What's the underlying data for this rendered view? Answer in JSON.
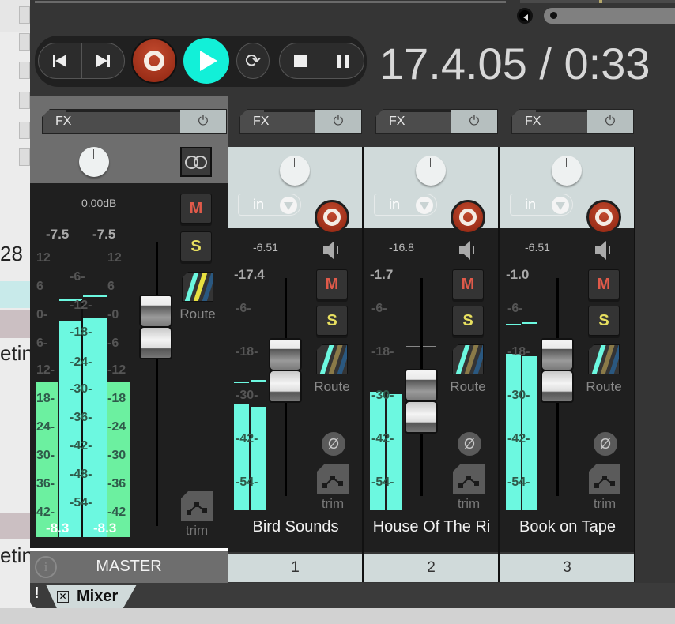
{
  "background": {
    "partial_texts": [
      "28",
      "etin",
      "etin"
    ]
  },
  "transport": {
    "buttons": [
      {
        "name": "go-to-start",
        "icon": "skip-back-icon",
        "glyph": "⏮"
      },
      {
        "name": "go-to-end",
        "icon": "skip-forward-icon",
        "glyph": "⏭"
      },
      {
        "name": "record",
        "icon": "record-icon"
      },
      {
        "name": "play",
        "icon": "play-icon"
      },
      {
        "name": "repeat",
        "icon": "loop-icon",
        "glyph": "⟳"
      },
      {
        "name": "stop",
        "icon": "stop-icon",
        "glyph": "■"
      },
      {
        "name": "pause",
        "icon": "pause-icon",
        "glyph": "❚❚"
      }
    ],
    "position": "17.4.05 / 0:33",
    "colors": {
      "record": "#a8321c",
      "play": "#12f0d8"
    }
  },
  "mixer": {
    "fx_label": "FX",
    "power_glyph": "⏻",
    "master": {
      "name": "MASTER",
      "volume_readout": "0.00dB",
      "peak_left": "-7.5",
      "peak_right": "-7.5",
      "rms_left": "-8.3",
      "rms_right": "-8.3",
      "mute_label": "M",
      "solo_label": "S",
      "route_label": "Route",
      "trim_label": "trim",
      "info_glyph": "i",
      "outer_scale": [
        "12",
        "6",
        "0-",
        "6-",
        "12-",
        "18-",
        "24-",
        "30-",
        "36-",
        "42-"
      ],
      "outer_scale_right": [
        "12",
        "6",
        "-0",
        "-6",
        "-12",
        "-18",
        "-24",
        "-30",
        "-36",
        "-42"
      ],
      "inner_scale": [
        "-6-",
        "-12-",
        "-18-",
        "-24-",
        "-30-",
        "-36-",
        "-42-",
        "-48-",
        "-54-"
      ]
    },
    "tracks": [
      {
        "number": "1",
        "name": "Bird Sounds",
        "input": "in",
        "volume_readout": "-6.51",
        "peak": "-17.4",
        "scale": [
          "-6-",
          "-18-",
          "-30-",
          "-42-",
          "-54-"
        ],
        "mute_label": "M",
        "solo_label": "S",
        "route_label": "Route",
        "trim_label": "trim",
        "phase_glyph": "Ø"
      },
      {
        "number": "2",
        "name": "House Of The Ri",
        "input": "in",
        "volume_readout": "-16.8",
        "peak": "-1.7",
        "scale": [
          "-6-",
          "-18-",
          "-30-",
          "-42-",
          "-54-"
        ],
        "mute_label": "M",
        "solo_label": "S",
        "route_label": "Route",
        "trim_label": "trim",
        "phase_glyph": "Ø"
      },
      {
        "number": "3",
        "name": "Book on Tape",
        "input": "in",
        "volume_readout": "-6.51",
        "peak": "-1.0",
        "scale": [
          "-6-",
          "-18-",
          "-30-",
          "-42-",
          "-54-"
        ],
        "mute_label": "M",
        "solo_label": "S",
        "route_label": "Route",
        "trim_label": "trim",
        "phase_glyph": "Ø"
      }
    ],
    "meter_colors": {
      "rms": "#6cf0a0",
      "peak": "#6cf8e0"
    }
  },
  "tabbar": {
    "alert": "!",
    "tab_label": "Mixer",
    "close_glyph": "✕"
  }
}
